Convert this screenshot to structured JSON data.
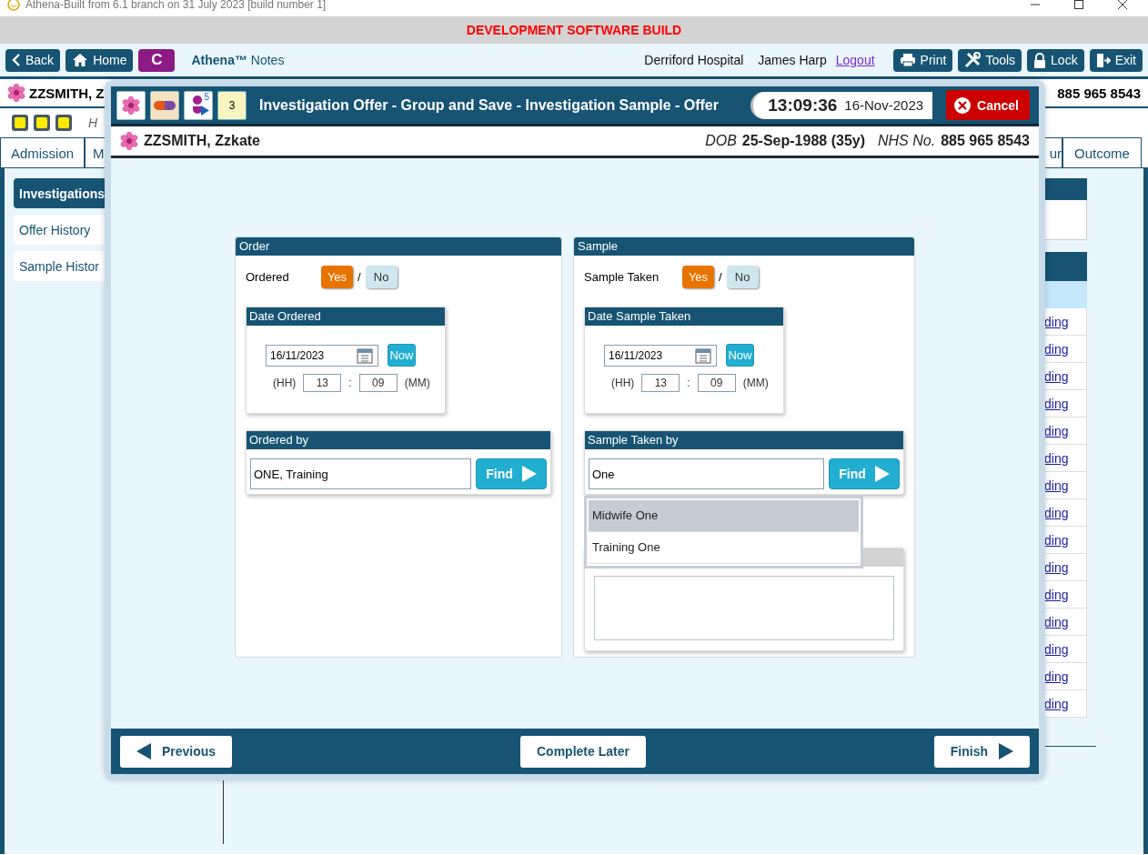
{
  "title_bar": {
    "title": "Athena-Built from 6.1 branch on 31 July 2023 [build number 1]"
  },
  "banner": "DEVELOPMENT SOFTWARE BUILD",
  "toolbar": {
    "left_buttons": [
      {
        "label": "Back",
        "kind": "back"
      },
      {
        "label": "Home",
        "kind": "home"
      },
      {
        "label": "C",
        "kind": "badge"
      }
    ],
    "app_brand": "Athena™",
    "app_suffix": "Notes",
    "hospital": "Derriford Hospital",
    "user": "James Harp",
    "logout": "Logout",
    "right_buttons": [
      {
        "label": "Print",
        "kind": "print"
      },
      {
        "label": "Tools",
        "kind": "tools"
      },
      {
        "label": "Lock",
        "kind": "lock"
      },
      {
        "label": "Exit",
        "kind": "exit"
      }
    ]
  },
  "patient_bar": {
    "name": "ZZSMITH, Z",
    "nhs_number": "885 965 8543"
  },
  "alert_row": {
    "text": "H"
  },
  "tabs": [
    {
      "label": "Admission",
      "selected": false
    },
    {
      "label": "M",
      "selected": false
    },
    {
      "label": "ur",
      "selected": false
    },
    {
      "label": "Outcome",
      "selected": false
    }
  ],
  "sidebar": {
    "items": [
      {
        "label": "Investigations",
        "selected": true
      },
      {
        "label": "Offer History",
        "selected": false
      },
      {
        "label": "Sample Histor",
        "selected": false
      }
    ]
  },
  "table": {
    "links": [
      "ding",
      "ding",
      "ding",
      "ding",
      "ding",
      "ding",
      "ding",
      "ding",
      "ding",
      "ding",
      "ding",
      "ding",
      "ding",
      "ding",
      "ding"
    ]
  },
  "dialog": {
    "header_icons": [
      {
        "kind": "flower"
      },
      {
        "kind": "pill"
      },
      {
        "kind": "figure",
        "badge": "5"
      },
      {
        "kind": "notepad",
        "badge": "3"
      }
    ],
    "title": "Investigation Offer - Group and Save - Investigation Sample - Offer",
    "time": "13:09:36",
    "date": "16-Nov-2023",
    "cancel": "Cancel",
    "patient": {
      "name": "ZZSMITH, Zzkate",
      "dob_label": "DOB",
      "dob": "25-Sep-1988 (35y)",
      "nhs_label": "NHS No.",
      "nhs_number": "885 965 8543"
    },
    "panels": [
      {
        "title": "Order",
        "question": "Ordered",
        "options": [
          {
            "label": "Yes",
            "selected": true
          },
          {
            "label": "No",
            "selected": false
          }
        ],
        "separator": "/",
        "date_box": {
          "title": "Date Ordered",
          "date": "16/11/2023",
          "now": "Now",
          "hh_label": "(HH)",
          "hours": "13",
          "colon": ":",
          "minutes": "09",
          "mm_label": "(MM)"
        },
        "person_box": {
          "title": "Ordered by",
          "value": "ONE, Training",
          "find": "Find"
        },
        "notes_box": false
      },
      {
        "title": "Sample",
        "question": "Sample Taken",
        "options": [
          {
            "label": "Yes",
            "selected": true
          },
          {
            "label": "No",
            "selected": false
          }
        ],
        "separator": "/",
        "date_box": {
          "title": "Date Sample Taken",
          "date": "16/11/2023",
          "now": "Now",
          "hh_label": "(HH)",
          "hours": "13",
          "colon": ":",
          "minutes": "09",
          "mm_label": "(MM)"
        },
        "person_box": {
          "title": "Sample Taken by",
          "value": "One",
          "find": "Find",
          "suggestions": [
            {
              "label": "Midwife One",
              "selected": true
            },
            {
              "label": "Training One",
              "selected": false
            }
          ]
        },
        "notes_box": true
      }
    ],
    "footer": {
      "previous": "Previous",
      "later": "Complete Later",
      "finish": "Finish"
    }
  }
}
